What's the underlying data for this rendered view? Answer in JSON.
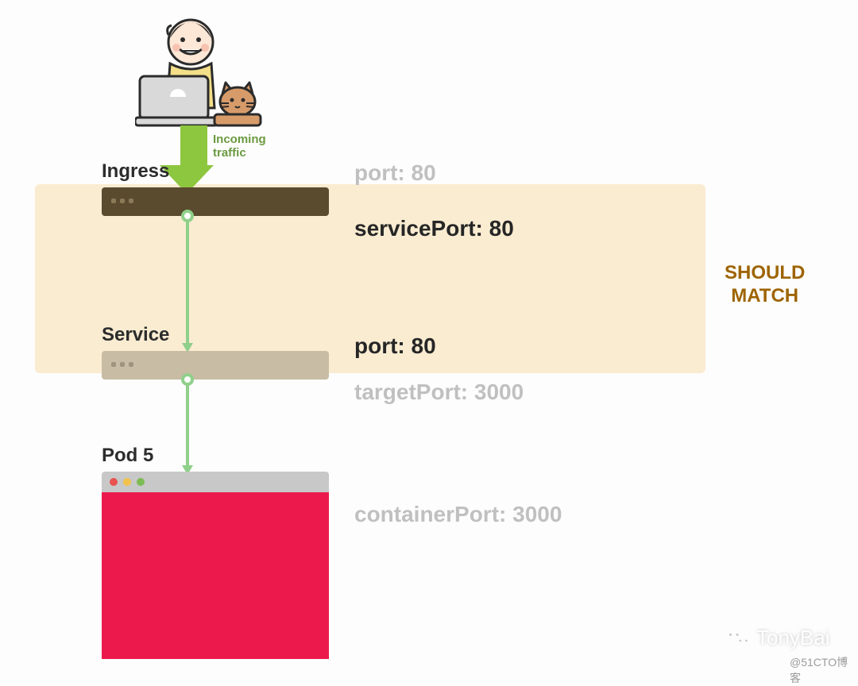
{
  "labels": {
    "ingress": "Ingress",
    "service": "Service",
    "pod": "Pod 5",
    "incoming": "Incoming traffic",
    "should_match": "SHOULD MATCH"
  },
  "ports": {
    "ingress_port": "port: 80",
    "service_port": "servicePort: 80",
    "svc_port": "port: 80",
    "target_port": "targetPort: 3000",
    "container_port": "containerPort: 3000"
  },
  "watermark": {
    "name": "TonyBai",
    "source": "@51CTO博客"
  },
  "colors": {
    "highlight": "#faecd1",
    "ingress_bar": "#5a4a2e",
    "service_bar": "#c8bca4",
    "pod_body": "#ec1a4c",
    "arrow": "#8dc63f",
    "flow": "#8fd08a",
    "should_match": "#9e6400",
    "tl_red": "#e8534f",
    "tl_yellow": "#f2c34a",
    "tl_green": "#7dbb53"
  }
}
